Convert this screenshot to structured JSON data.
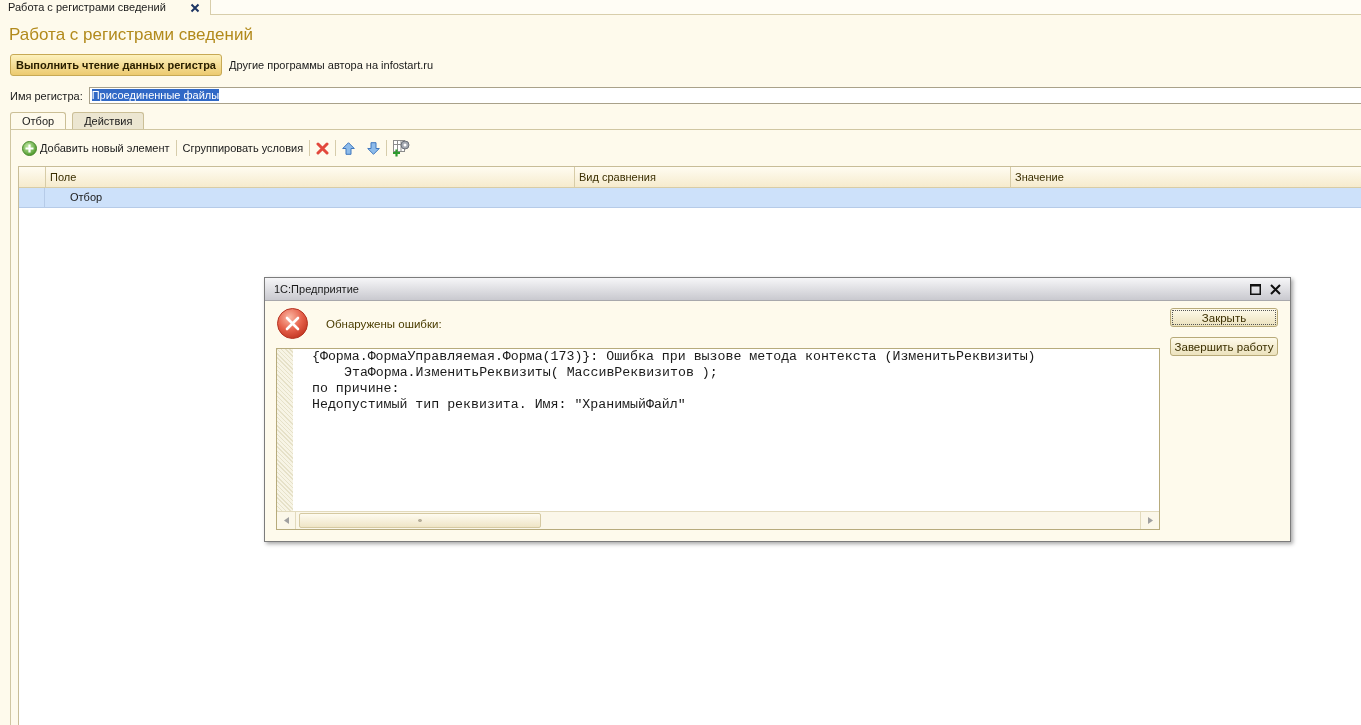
{
  "window_tabs": [
    {
      "title": "Работа с регистрами сведений",
      "selected": true
    }
  ],
  "form": {
    "title": "Работа с регистрами сведений",
    "read_button": {
      "label": "Выполнить чтение данных регистра"
    },
    "author_link": {
      "label": "Другие программы автора на infostart.ru"
    },
    "register_field": {
      "label": "Имя регистра:",
      "value": "Присоединенные файлы",
      "value_selected": true
    }
  },
  "tabs": [
    {
      "label": "Отбор",
      "selected": true
    },
    {
      "label": "Действия",
      "selected": false
    }
  ],
  "toolbar": {
    "add_button": {
      "label": "Добавить новый элемент"
    },
    "group_button": {
      "label": "Сгруппировать условия"
    }
  },
  "table": {
    "columns": [
      "Поле",
      "Вид сравнения",
      "Значение"
    ],
    "rows": [
      {
        "field": "Отбор",
        "selected": true
      }
    ]
  },
  "dialog": {
    "title": "1С:Предприятие",
    "heading": "Обнаружены ошибки:",
    "message_lines": [
      {
        "text": "{Форма.ФормаУправляемая.Форма(173)}: Ошибка при вызове метода контекста (ИзменитьРеквизиты)",
        "children": [
          {
            "text": "ЭтаФорма.ИзменитьРеквизиты( МассивРеквизитов );"
          }
        ]
      },
      {
        "text": "по причине:"
      },
      {
        "text": "Недопустимый тип реквизита. Имя: \"ХранимыйФайл\""
      }
    ],
    "buttons": [
      {
        "label": "Закрыть",
        "focused": true
      },
      {
        "label": "Завершить работу",
        "focused": false
      }
    ]
  }
}
